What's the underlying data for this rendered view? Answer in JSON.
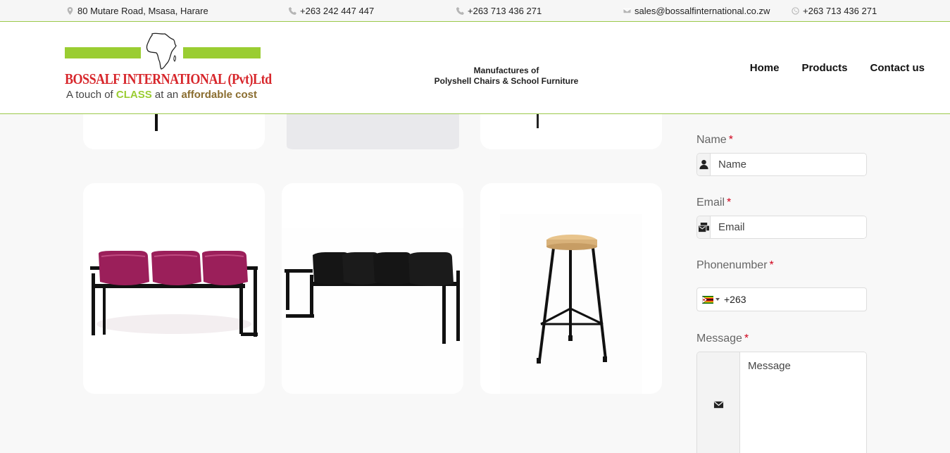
{
  "topbar": {
    "address": "80 Mutare Road, Msasa, Harare",
    "phone1": "+263 242 447 447",
    "phone2": "+263 713 436 271",
    "email": "sales@bossalfinternational.co.zw",
    "whatsapp": "+263 713 436 271"
  },
  "logo": {
    "brand": "BOSSALF INTERNATIONAL (Pvt)Ltd",
    "tagline_pre": "A touch of ",
    "tagline_class": "CLASS",
    "tagline_mid": " at an ",
    "tagline_aff": "affordable cost"
  },
  "header": {
    "motto_line1": "Manufactures of",
    "motto_line2": "Polyshell Chairs & School Furniture"
  },
  "nav": [
    "Home",
    "Products",
    "Contact us"
  ],
  "products": [
    {
      "name": "three-seater-bench-magenta",
      "seat_color": "#9b1f5a"
    },
    {
      "name": "four-seater-bench-black",
      "seat_color": "#1a1a1a"
    },
    {
      "name": "lab-stool",
      "seat_color": "#e8c48c"
    }
  ],
  "form": {
    "name_label": "Name",
    "name_placeholder": "Name",
    "email_label": "Email",
    "email_placeholder": "Email",
    "phone_label": "Phonenumber",
    "phone_value": "+263",
    "message_label": "Message",
    "message_placeholder": "Message",
    "required_mark": "*"
  },
  "colors": {
    "accent_green": "#9acd32",
    "brand_red": "#d7262b",
    "required_red": "#d0021b"
  }
}
